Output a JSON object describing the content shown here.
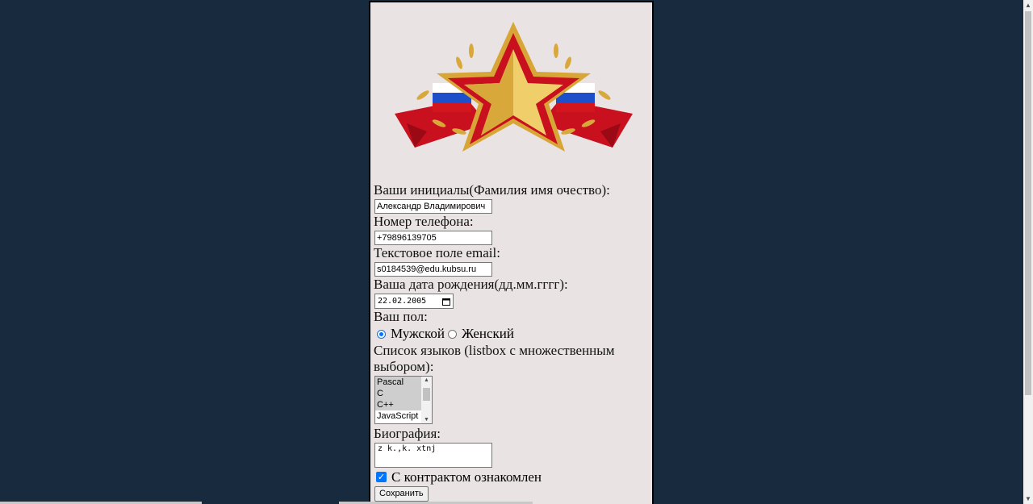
{
  "form": {
    "fio_label": "Ваши инициалы(Фамилия имя очество):",
    "fio_value": "Александр Владимирович",
    "phone_label": "Номер телефона:",
    "phone_value": "+79896139705",
    "email_label": "Текстовое поле email:",
    "email_value": "s0184539@edu.kubsu.ru",
    "birth_label": "Ваша дата рождения(дд.мм.гггг):",
    "birth_value": "22.02.2005",
    "gender_label": "Ваш пол:",
    "gender_male": "Мужской",
    "gender_female": "Женский",
    "langs_label": "Список языков (listbox с множественным выбором):",
    "langs": [
      "Pascal",
      "C",
      "C++",
      "JavaScript"
    ],
    "bio_label": "Биография:",
    "bio_value": "z k.,k. xtnj",
    "contract_label": "С контрактом ознакомлен",
    "save_label": "Сохранить"
  },
  "icons": {
    "calendar": "calendar-icon",
    "emblem": "red-star-emblem"
  },
  "colors": {
    "background": "#172a3e",
    "panel": "#e9e3e3",
    "accent": "#0075ff"
  }
}
